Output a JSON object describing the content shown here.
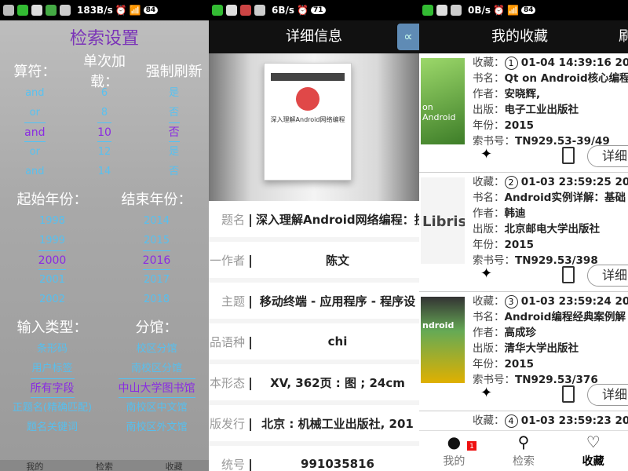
{
  "status": [
    {
      "speed": "183B/s",
      "net": "",
      "batt": "84"
    },
    {
      "speed": "6B/s",
      "net": "",
      "batt": "71"
    },
    {
      "speed": "0B/s",
      "net": "",
      "batt": "84"
    }
  ],
  "search_settings": {
    "title": "检索设置",
    "hdr_op": "算符：",
    "hdr_batch": "单次加载：",
    "hdr_refresh": "强制刷新",
    "ops": [
      "and",
      "or",
      "and",
      "or",
      "and"
    ],
    "batch": [
      "6",
      "8",
      "10",
      "12",
      "14"
    ],
    "refresh": [
      "是",
      "否",
      "否",
      "是",
      "否"
    ],
    "hdr_start": "起始年份：",
    "hdr_end": "结束年份：",
    "start_years": [
      "1998",
      "1999",
      "2000",
      "2001",
      "2002"
    ],
    "end_years": [
      "2014",
      "2015",
      "2016",
      "2017",
      "2018"
    ],
    "hdr_type": "输入类型：",
    "hdr_branch": "分馆：",
    "types": [
      "条形码",
      "用户标签",
      "所有字段",
      "正题名(精确匹配)",
      "题名关键词"
    ],
    "branches": [
      "校区分馆",
      "南校区分馆",
      "中山大学图书馆",
      "南校区中文馆",
      "南校区外文馆"
    ],
    "bottom_tabs": [
      "我的",
      "检索",
      "收藏"
    ]
  },
  "detail": {
    "title": "详细信息",
    "share_icon": "share",
    "rows": [
      {
        "label": "题名",
        "value": "深入理解Android网络编程：技"
      },
      {
        "label": "一作者",
        "value": "陈文"
      },
      {
        "label": "主题",
        "value": "移动终端 - 应用程序 - 程序设"
      },
      {
        "label": "品语种",
        "value": "chi"
      },
      {
        "label": "本形态",
        "value": "XV, 362页 : 图 ; 24cm"
      },
      {
        "label": "版发行",
        "value": "北京 : 机械工业出版社, 201"
      },
      {
        "label": "统号",
        "value": "991035816"
      }
    ]
  },
  "favorites": {
    "title": "我的收藏",
    "right_title": "刷",
    "items": [
      {
        "num": "1",
        "time": "01-04 14:39:16 20",
        "title": "Qt on Android核心编程",
        "author": "安晓辉,",
        "publisher": "电子工业出版社",
        "year": "2015",
        "call": "TN929.53-39/49",
        "thumb": "#5a9e3a"
      },
      {
        "num": "2",
        "time": "01-03 23:59:25 20",
        "title": "Android实例详解：基础",
        "author": "韩迪",
        "publisher": "北京邮电大学出版社",
        "year": "2015",
        "call": "TN929.53/398",
        "thumb": "#f0f0f0"
      },
      {
        "num": "3",
        "time": "01-03 23:59:24 20",
        "title": "Android编程经典案例解",
        "author": "高成珍",
        "publisher": "清华大学出版社",
        "year": "2015",
        "call": "TN929.53/376",
        "thumb": "#d9a400"
      },
      {
        "num": "4",
        "time": "01-03 23:59:23 20",
        "title": "",
        "author": "",
        "publisher": "",
        "year": "",
        "call": "",
        "thumb": "#ccc"
      }
    ],
    "labels": {
      "k1": "收藏：",
      "k2": "书名：",
      "k3": "作者：",
      "k4": "出版：",
      "k5": "年份：",
      "k6": "索书号："
    },
    "detail_btn": "详细",
    "tabs": [
      {
        "label": "我的",
        "icon": "person-icon"
      },
      {
        "label": "检索",
        "icon": "search-icon"
      },
      {
        "label": "收藏",
        "icon": "heart-icon"
      }
    ],
    "badge": "1"
  }
}
